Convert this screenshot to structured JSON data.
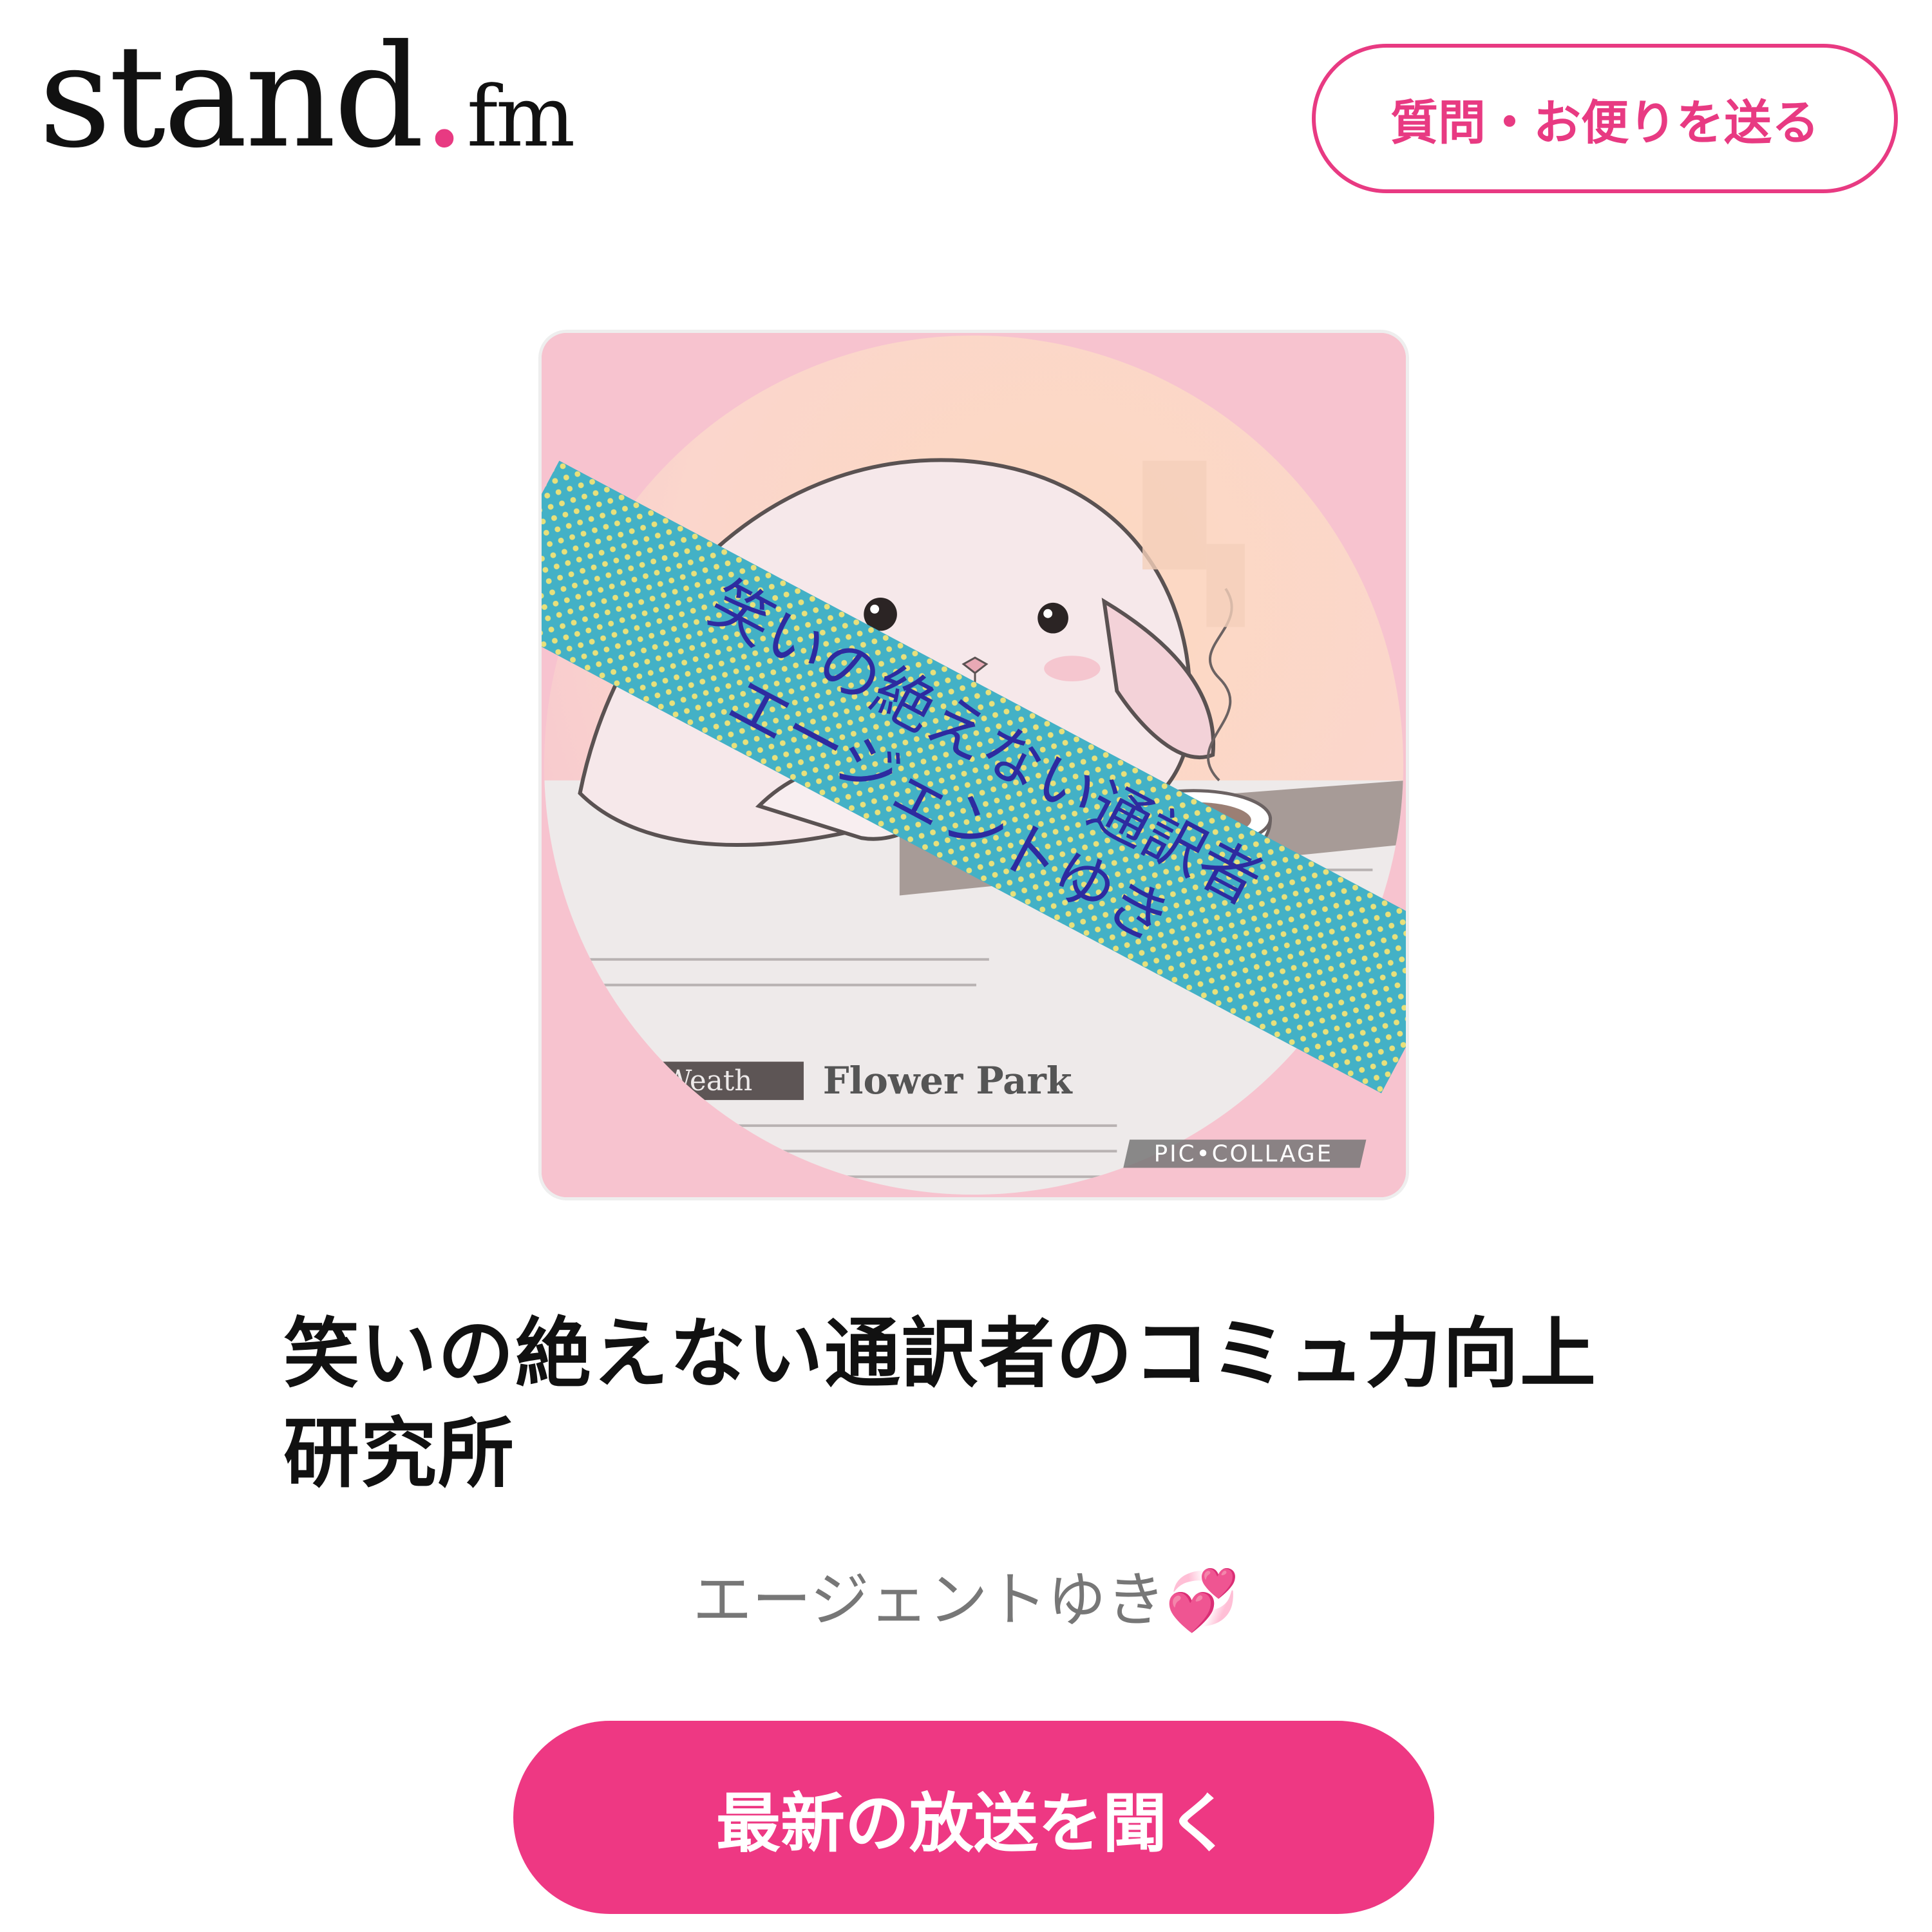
{
  "header": {
    "logo_main": "stand",
    "logo_dot": ".",
    "logo_suffix": "fm",
    "letter_button_label": "質問・お便りを送る"
  },
  "cover": {
    "banner_line1": "笑いの絶えない通訳者",
    "banner_line2": "エージェントゆき",
    "newspaper_text": "Flower Park",
    "newspaper_text2": "Weath",
    "watermark": "PIC•COLLAGE"
  },
  "channel": {
    "title_line1": "笑いの絶えない通訳者のコミュ力向上",
    "title_line2": "研究所",
    "author": "エージェントゆき",
    "author_emoji": "💞"
  },
  "actions": {
    "play_label": "最新の放送を聞く"
  },
  "colors": {
    "accent": "#ee3883",
    "title": "#111111",
    "author": "#777777"
  }
}
